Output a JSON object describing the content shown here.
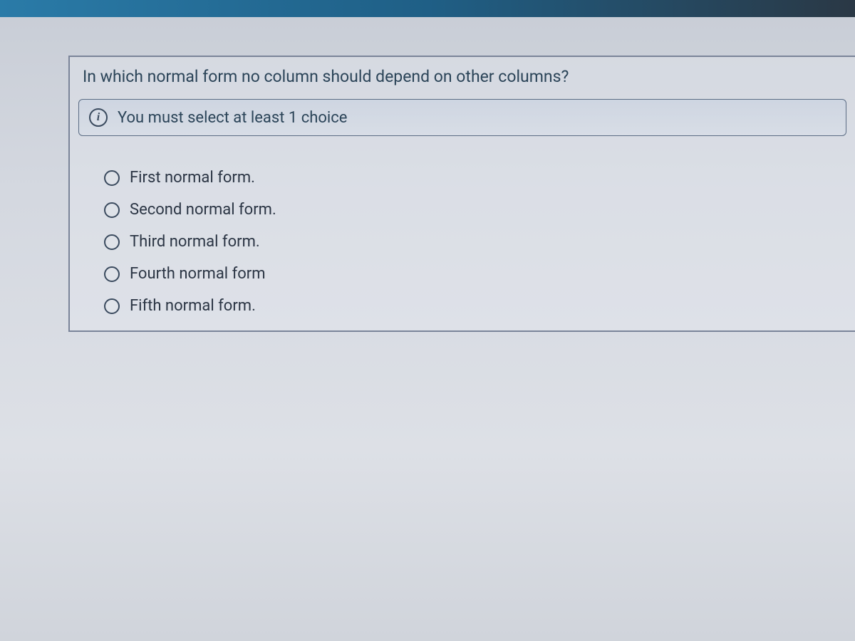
{
  "question": {
    "text": "In which normal form no column should depend on other columns?"
  },
  "info": {
    "message": "You must select at least 1 choice"
  },
  "choices": [
    {
      "label": "First normal form."
    },
    {
      "label": "Second normal form."
    },
    {
      "label": "Third normal form."
    },
    {
      "label": "Fourth normal form"
    },
    {
      "label": "Fifth normal form."
    }
  ]
}
